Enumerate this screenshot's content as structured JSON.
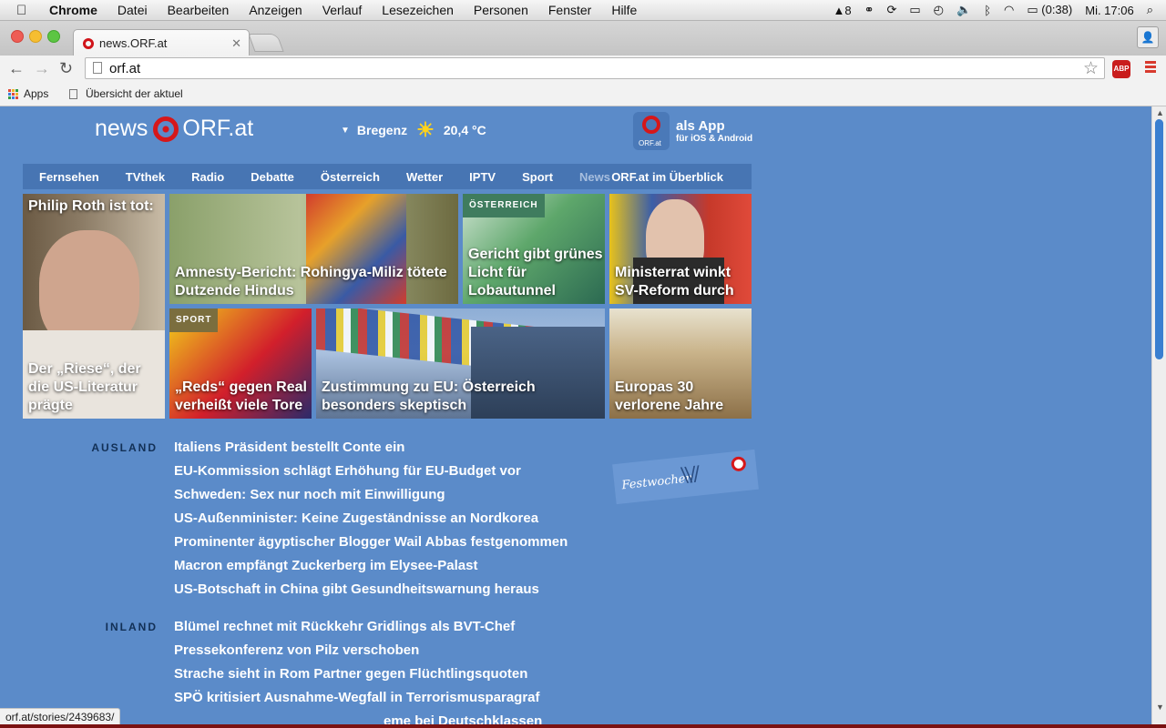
{
  "os_menubar": {
    "app": "Chrome",
    "items": [
      "Datei",
      "Bearbeiten",
      "Anzeigen",
      "Verlauf",
      "Lesezeichen",
      "Personen",
      "Fenster",
      "Hilfe"
    ],
    "tray_count": "8",
    "battery": "(0:38)",
    "clock": "Mi. 17:06"
  },
  "browser": {
    "tab_title": "news.ORF.at",
    "url": "orf.at",
    "bookmarks": [
      "Apps",
      "Übersicht der aktuel"
    ],
    "abp_label": "ABP",
    "status_url": "orf.at/stories/2439683/"
  },
  "header": {
    "logo_left": "news",
    "logo_right": "ORF.at",
    "weather_city": "Bregenz",
    "weather_temp": "20,4 °C",
    "app_line1": "als App",
    "app_line2": "für iOS & Android",
    "app_icon_label": "ORF.at"
  },
  "nav": {
    "items": [
      "Fernsehen",
      "TVthek",
      "Radio",
      "Debatte",
      "Österreich",
      "Wetter",
      "IPTV",
      "Sport",
      "News"
    ],
    "overview": "ORF.at im Überblick"
  },
  "teasers": {
    "roth_top": "Philip Roth ist tot:",
    "roth_bottom": "Der „Riese“, der die US-Literatur prägte",
    "amnesty": "Amnesty-Bericht: Rohingya-Miliz tötete Dutzende Hindus",
    "lobau_kicker": "ÖSTERREICH",
    "lobau": "Gericht gibt grünes Licht für Lobautunnel",
    "ministerrat": "Ministerrat winkt SV-Reform durch",
    "reds_kicker": "SPORT",
    "reds": "„Reds“ gegen Real verheißt viele Tore",
    "eu": "Zustimmung zu EU: Österreich besonders skeptisch",
    "europa": "Europas 30 verlorene Jahre"
  },
  "ausland": {
    "label": "AUSLAND",
    "items": [
      "Italiens Präsident bestellt Conte ein",
      "EU-Kommission schlägt Erhöhung für EU-Budget vor",
      "Schweden: Sex nur noch mit Einwilligung",
      "US-Außenminister: Keine Zugeständnisse an Nordkorea",
      "Prominenter ägyptischer Blogger Wail Abbas festgenommen",
      "Macron empfängt Zuckerberg im Elysee-Palast",
      "US-Botschaft in China gibt Gesundheitswarnung heraus"
    ]
  },
  "inland": {
    "label": "INLAND",
    "items": [
      "Blümel rechnet mit Rückkehr Gridlings als BVT-Chef",
      "Pressekonferenz von Pilz verschoben",
      "Strache sieht in Rom Partner gegen Flüchtlingsquoten",
      "SPÖ kritisiert Ausnahme-Wegfall in Terrorismusparagraf",
      "eme bei Deutschklassen"
    ]
  },
  "festwochen": {
    "label": "Festwochen"
  },
  "colors": {
    "page_bg": "#5b8bc9",
    "nav_bg": "#4775b3",
    "orf_red": "#d6171a",
    "section_label": "#123056"
  }
}
